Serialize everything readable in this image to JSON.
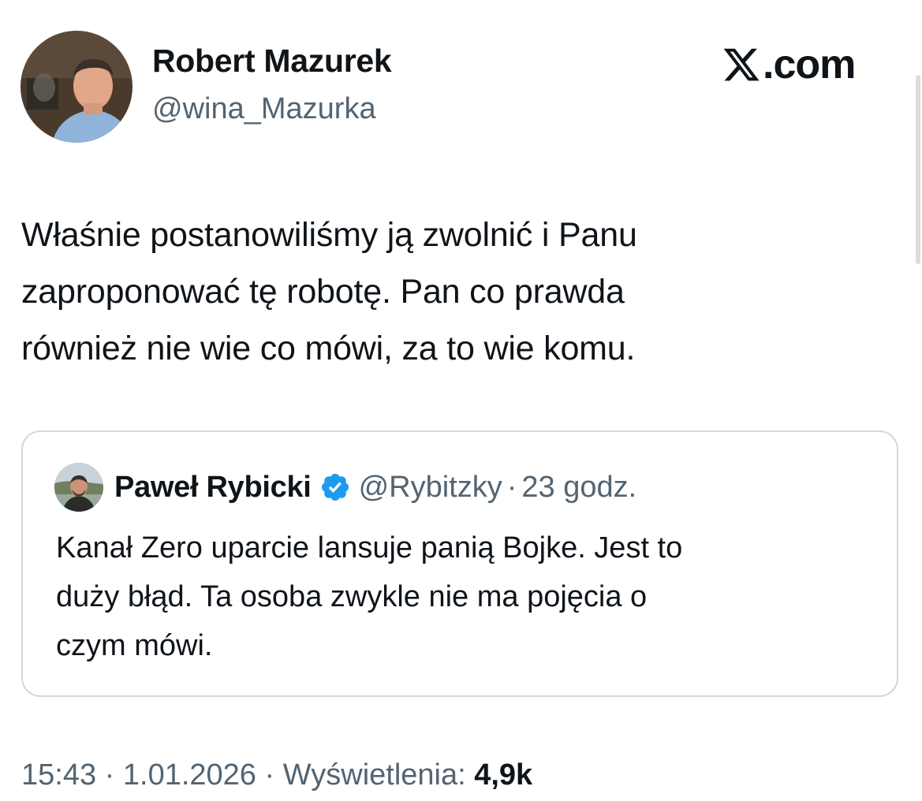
{
  "tweet": {
    "author": {
      "name": "Robert Mazurek",
      "handle": "@wina_Mazurka"
    },
    "text_lines": [
      "Właśnie postanowiliśmy ją zwolnić i Panu",
      "zaproponować tę robotę. Pan co prawda",
      "również nie wie co mówi, za to wie komu."
    ],
    "time": "15:43",
    "separator": "·",
    "date": "1.01.2026",
    "views_label": "Wyświetlenia:",
    "views_count": "4,9k"
  },
  "brand": {
    "logo_icon": "x-logo-icon",
    "text": ".com"
  },
  "quoted_tweet": {
    "name": "Paweł Rybicki",
    "verified_icon": "verified-badge-icon",
    "verified_color": "#1d9bf0",
    "handle": "@Rybitzky",
    "separator": "·",
    "time": "23 godz.",
    "text_lines": [
      "Kanał Zero uparcie lansuje panią Bojke. Jest to",
      "duży błąd. Ta osoba zwykle nie ma pojęcia o",
      "czym mówi."
    ]
  },
  "colors": {
    "text_primary": "#0f1419",
    "text_secondary": "#536471",
    "border": "#cfd9de"
  }
}
